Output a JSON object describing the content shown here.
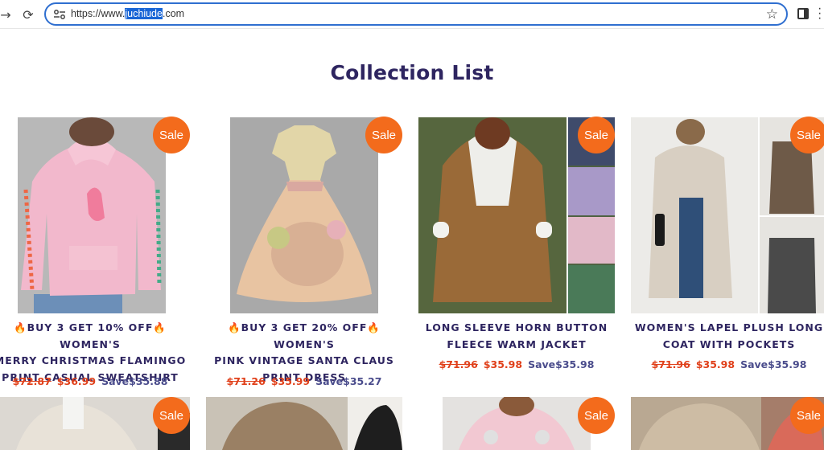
{
  "browser": {
    "url_prefix": "https://www.",
    "url_highlight": "juchiude",
    "url_suffix": ".com"
  },
  "page": {
    "title": "Collection List",
    "sale_badge": "Sale"
  },
  "products": [
    {
      "name_lines": [
        "🔥BUY 3 GET 10% OFF🔥WOMEN'S",
        "MERRY CHRISTMAS FLAMINGO",
        "PRINT CASUAL SWEATSHIRT"
      ],
      "old_price": "$72.87",
      "price": "$36.99",
      "save": "Save$35.88"
    },
    {
      "name_lines": [
        "🔥BUY 3 GET 20% OFF🔥WOMEN'S",
        "PINK VINTAGE SANTA CLAUS",
        "PRINT DRESS"
      ],
      "old_price": "$71.26",
      "price": "$35.99",
      "save": "Save$35.27"
    },
    {
      "name_lines": [
        "LONG SLEEVE HORN BUTTON",
        "FLEECE WARM JACKET"
      ],
      "old_price": "$71.96",
      "price": "$35.98",
      "save": "Save$35.98"
    },
    {
      "name_lines": [
        "WOMEN'S LAPEL PLUSH LONG",
        "COAT WITH POCKETS"
      ],
      "old_price": "$71.96",
      "price": "$35.98",
      "save": "Save$35.98"
    }
  ],
  "colors": {
    "title": "#2e2560",
    "sale_badge": "#f36b1c",
    "price_red": "#e0401a",
    "save_blue": "#4a4c8c"
  }
}
